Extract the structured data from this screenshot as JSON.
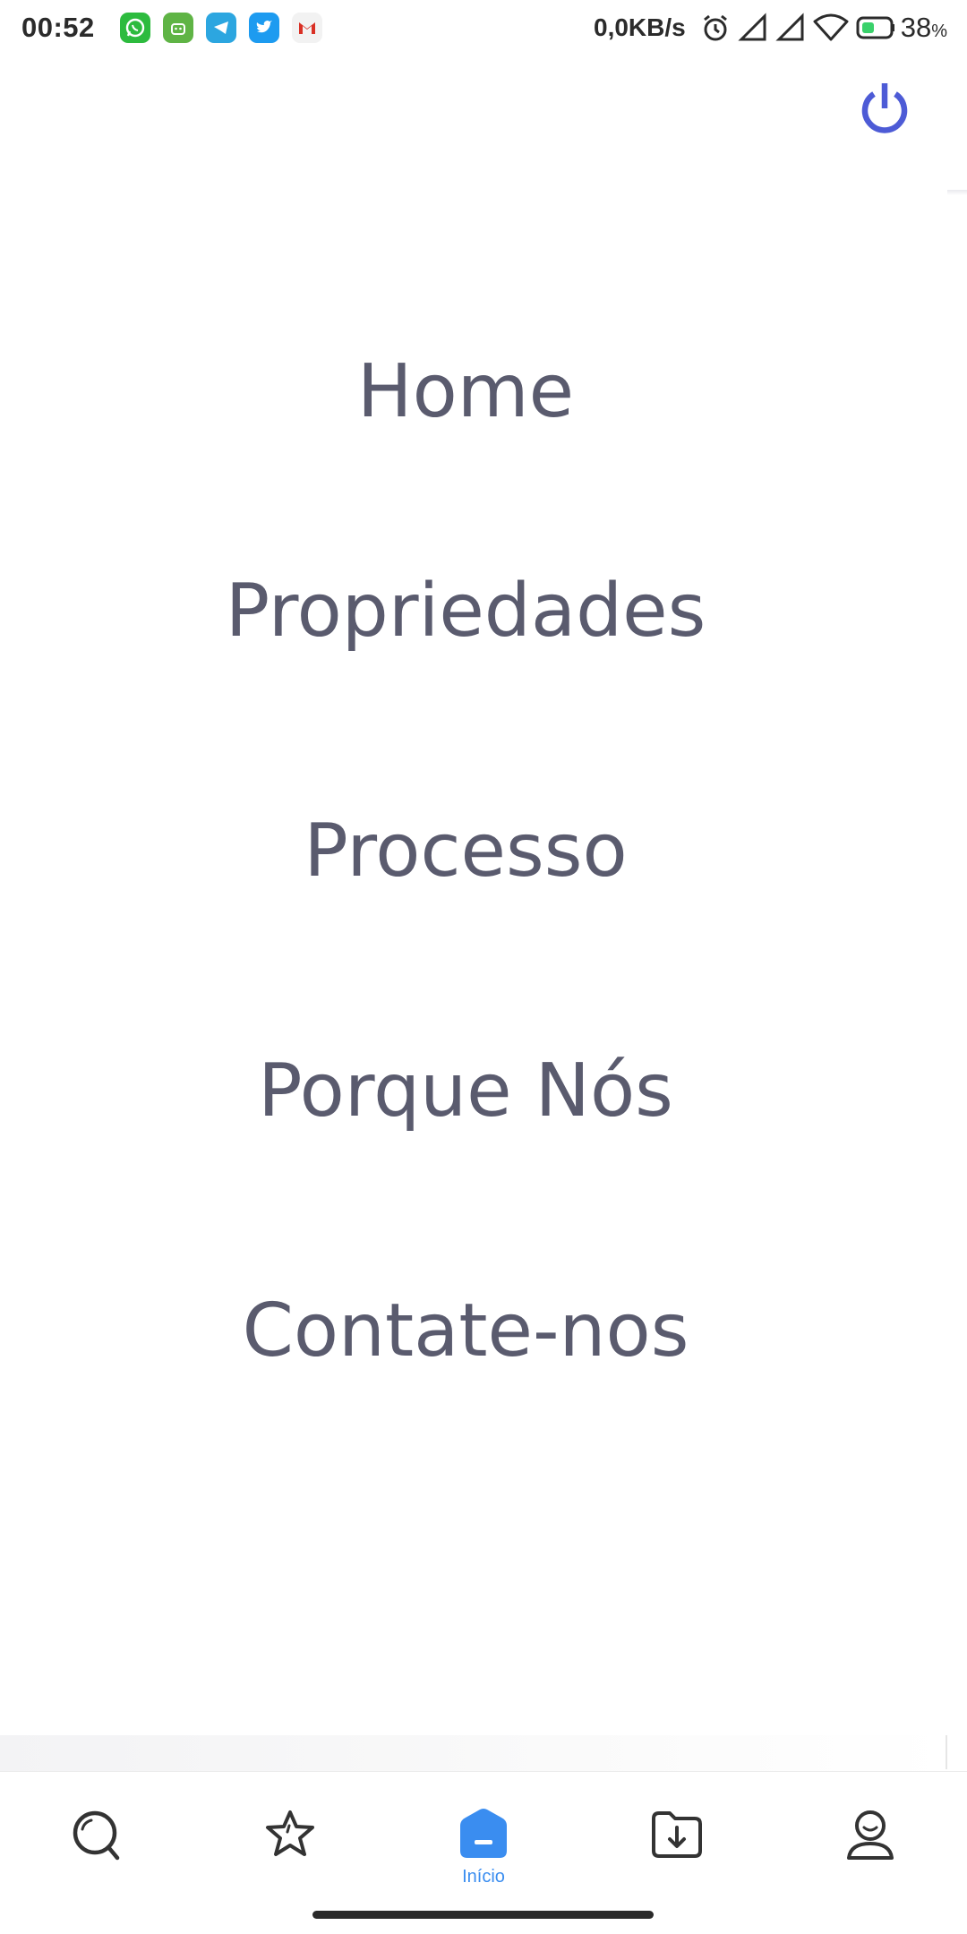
{
  "status_bar": {
    "time": "00:52",
    "net_speed": "0,0KB/s",
    "battery_value": "38",
    "battery_unit": "%",
    "notification_icons": [
      "whatsapp-icon",
      "android-icon",
      "telegram-icon",
      "twitter-icon",
      "gmail-icon"
    ]
  },
  "header": {
    "power_icon": "power-icon",
    "accent_color": "#4d5bd6"
  },
  "menu": {
    "items": [
      {
        "label": "Home"
      },
      {
        "label": "Propriedades"
      },
      {
        "label": "Processo"
      },
      {
        "label": "Porque Nós"
      },
      {
        "label": "Contate-nos"
      }
    ],
    "text_color": "#5a5b6e"
  },
  "bottom_nav": {
    "active_color": "#3a8df0",
    "items": [
      {
        "icon": "search-icon"
      },
      {
        "icon": "star-icon"
      },
      {
        "icon": "home-icon",
        "label": "Início",
        "active": true
      },
      {
        "icon": "download-folder-icon"
      },
      {
        "icon": "profile-icon"
      }
    ]
  }
}
